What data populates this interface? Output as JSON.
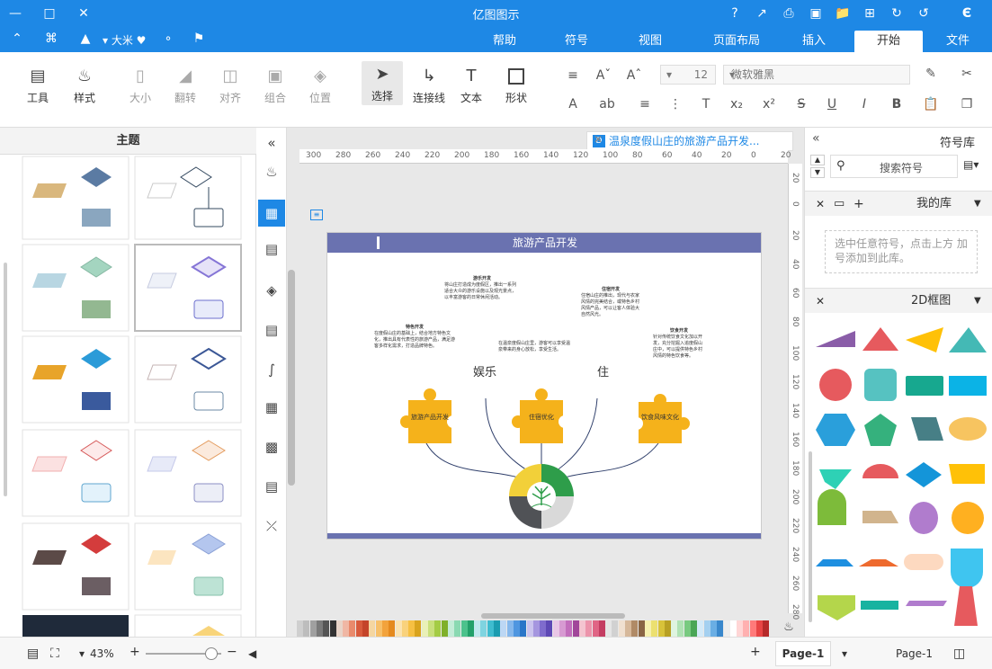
{
  "title_bar": {
    "app_title": "亿图图示"
  },
  "menu_tabs": [
    {
      "label": "文件"
    },
    {
      "label": "开始"
    },
    {
      "label": "插入"
    },
    {
      "label": "页面布局"
    },
    {
      "label": "视图"
    },
    {
      "label": "符号"
    },
    {
      "label": "帮助"
    }
  ],
  "user": {
    "name": "大米"
  },
  "ribbon": {
    "font_name": "微软雅黑",
    "font_size": "12",
    "tools": [
      {
        "label": "形状"
      },
      {
        "label": "文本"
      },
      {
        "label": "连接线"
      },
      {
        "label": "选择"
      },
      {
        "label": "位置"
      },
      {
        "label": "组合"
      },
      {
        "label": "对齐"
      },
      {
        "label": "翻转"
      },
      {
        "label": "大小"
      },
      {
        "label": "样式"
      },
      {
        "label": "工具"
      }
    ]
  },
  "symbol_library": {
    "header": "符号库",
    "search_placeholder": "搜索符号",
    "my_library": "我的库",
    "my_library_hint": "选中任意符号，点击上方 加号添加到此库。",
    "category_2d": "2D框图"
  },
  "document_tab": {
    "label": "温泉度假山庄的旅游产品开发..."
  },
  "ruler": {
    "h_ticks": [
      "20",
      "0",
      "20",
      "40",
      "60",
      "80",
      "100",
      "120",
      "140",
      "160",
      "180",
      "200",
      "220",
      "240",
      "260",
      "280",
      "300"
    ],
    "v_ticks": [
      "20",
      "0",
      "20",
      "40",
      "60",
      "80",
      "100",
      "120",
      "140",
      "160",
      "180",
      "200",
      "220",
      "240",
      "260",
      "280"
    ]
  },
  "diagram": {
    "title": "旅游产品开发",
    "char_stay": "住",
    "char_play": "娱乐",
    "puzzles": [
      {
        "label": "饮食风味文化"
      },
      {
        "label": "住宿优化"
      },
      {
        "label": "旅游产品开发"
      }
    ],
    "block_food": {
      "title": "饮食开发",
      "text": "针对传统饮食文化加以开发，充分挖掘入追度假山庄中，可以提供特色乡村风情的特色饮食等。"
    },
    "block_culture": {
      "title": "住宿开发",
      "text": "住宿山庄的推出，现代与农家风情的完美结合，或特色乡村风情产品，可以让客人体验大自然风光。"
    },
    "block_enter": {
      "title": "游乐开发",
      "text": "将山庄打造成为度假区，推出一系列适合大众的游乐设施以及观光景点，以丰富游客的日常休闲活动。"
    },
    "block_special": {
      "title": "特色开发",
      "text": "在度假山庄的基础上，结合地方特色文化，推出具有代表性的旅游产品，满足游客多样化需求，打造品牌特色。"
    },
    "block_mid": {
      "text": "在温泉度假山庄里，游客可以享受温泉带来的身心放松，享受生活。"
    }
  },
  "sidebar": {
    "header": "主题"
  },
  "status": {
    "page_label": "Page-1",
    "page_tab": "Page-1",
    "zoom": "43%"
  },
  "colors": {
    "accent": "#1e88e5",
    "puzzle": "#f5b21b",
    "header_bar": "#6a72b0"
  }
}
